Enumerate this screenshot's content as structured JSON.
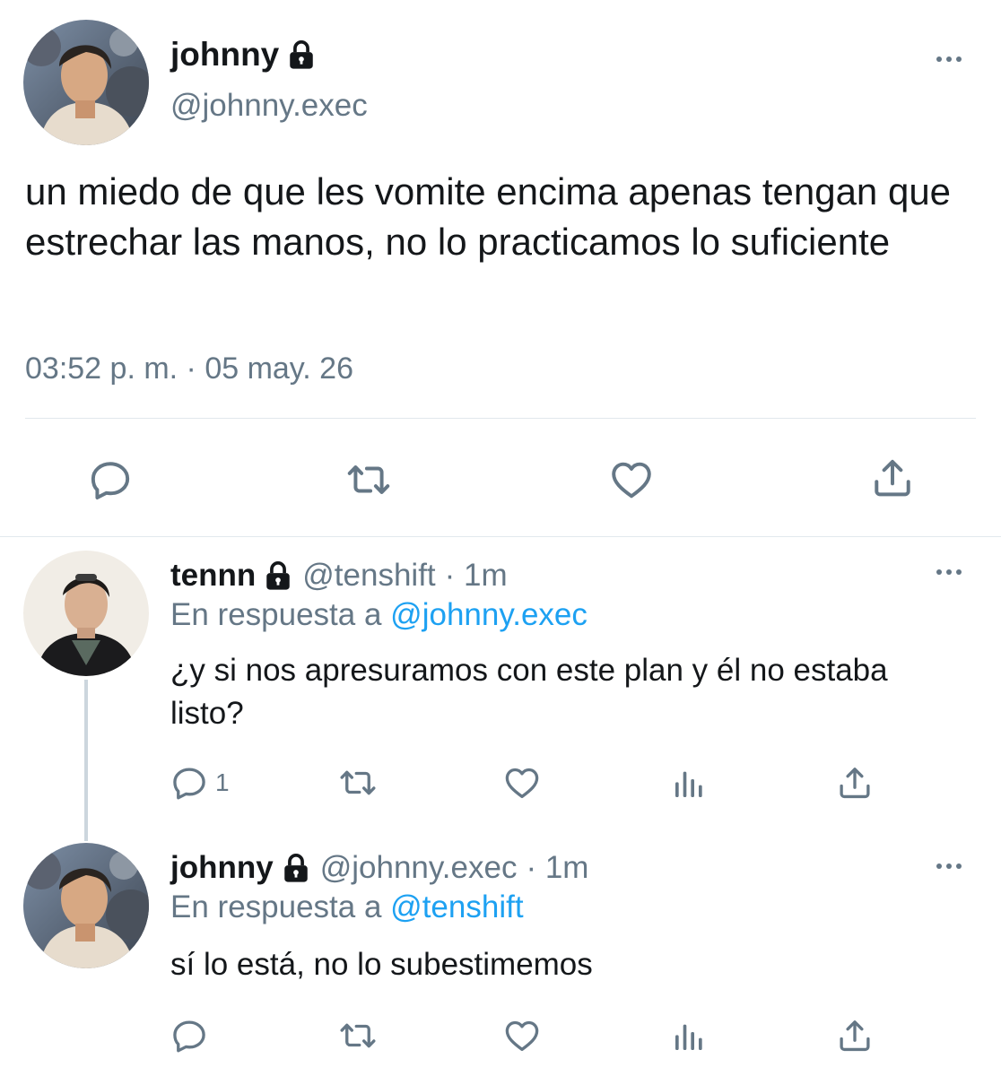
{
  "main_tweet": {
    "name": "johnny",
    "handle": "@johnny.exec",
    "text": "un miedo de que les vomite encima apenas tengan que estrechar las manos, no lo practicamos lo suficiente",
    "timestamp": "03:52 p. m. · 05 may. 26",
    "icons": {
      "lock": "lock-icon",
      "more": "more-icon",
      "reply": "reply-icon",
      "retweet": "retweet-icon",
      "like": "like-icon",
      "share": "share-icon"
    }
  },
  "replies": [
    {
      "name": "tennn",
      "handle": "@tenshift",
      "time": "· 1m",
      "reply_prefix": "En respuesta a",
      "reply_to": "@johnny.exec",
      "text": "¿y si nos apresuramos con este plan y él no estaba listo?",
      "reply_count": "1"
    },
    {
      "name": "johnny",
      "handle": "@johnny.exec",
      "time": "· 1m",
      "reply_prefix": "En respuesta a",
      "reply_to": "@tenshift",
      "text": "sí lo está, no lo subestimemos",
      "reply_count": ""
    }
  ],
  "colors": {
    "text": "#14171a",
    "muted": "#657786",
    "link": "#1da1f2",
    "divider": "#e1e8ed"
  }
}
